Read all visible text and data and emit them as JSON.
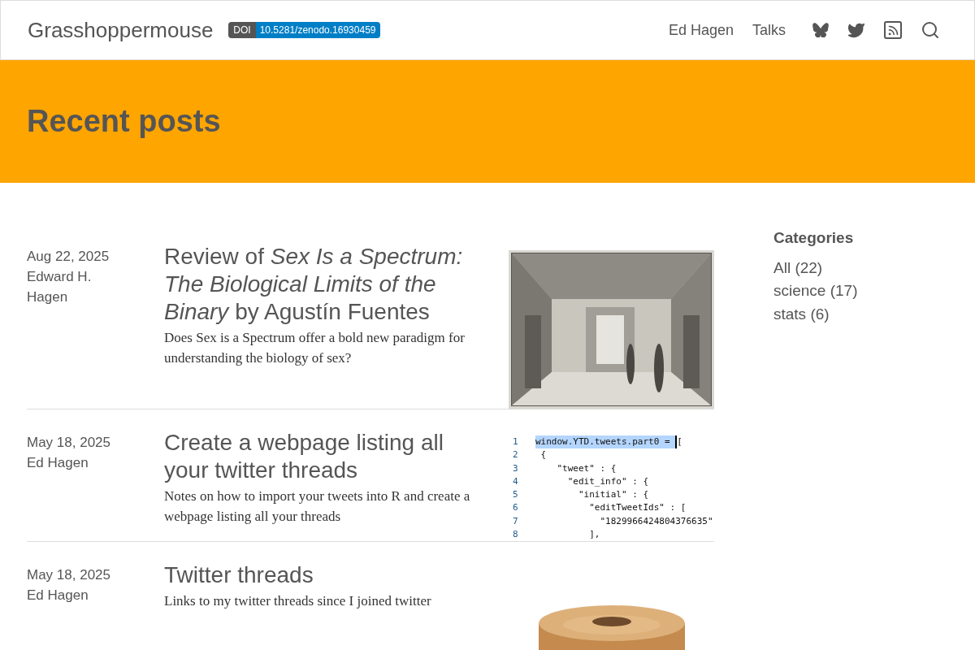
{
  "header": {
    "site_title": "Grasshoppermouse",
    "doi": {
      "label": "DOI",
      "value": "10.5281/zenodo.16930459"
    },
    "nav": [
      "Ed Hagen",
      "Talks"
    ]
  },
  "banner": {
    "title": "Recent posts"
  },
  "posts": [
    {
      "date": "Aug 22, 2025",
      "author": "Edward H. Hagen",
      "title": "Review of *Sex Is a Spectrum: The Biological Limits of the Binary* by Agustín Fuentes",
      "description": "Does Sex is a Spectrum offer a bold new paradigm for understanding the biology of sex?",
      "thumbnail": {
        "kind": "engraving"
      }
    },
    {
      "date": "May 18, 2025",
      "author": "Ed Hagen",
      "title": "Create a webpage listing all your twitter threads",
      "description": "Notes on how to import your tweets into R and create a webpage listing all your threads",
      "thumbnail": {
        "kind": "code",
        "lines": [
          {
            "number": "1",
            "text": "window.YTD.tweets.part0 = ",
            "tail": "[",
            "highlighted": true
          },
          {
            "number": "2",
            "text": " {",
            "highlighted": false
          },
          {
            "number": "3",
            "text": "    \"tweet\" : {",
            "highlighted": false
          },
          {
            "number": "4",
            "text": "      \"edit_info\" : {",
            "highlighted": false
          },
          {
            "number": "5",
            "text": "        \"initial\" : {",
            "highlighted": false
          },
          {
            "number": "6",
            "text": "          \"editTweetIds\" : [",
            "highlighted": false
          },
          {
            "number": "7",
            "text": "            \"1829966424804376635\"",
            "highlighted": false
          },
          {
            "number": "8",
            "text": "          ],",
            "highlighted": false
          }
        ]
      }
    },
    {
      "date": "May 18, 2025",
      "author": "Ed Hagen",
      "title": "Twitter threads",
      "description": "Links to my twitter threads since I joined twitter",
      "thumbnail": {
        "kind": "disc"
      }
    }
  ],
  "sidebar": {
    "heading": "Categories",
    "categories": [
      "All (22)",
      "science (17)",
      "stats (6)"
    ]
  }
}
